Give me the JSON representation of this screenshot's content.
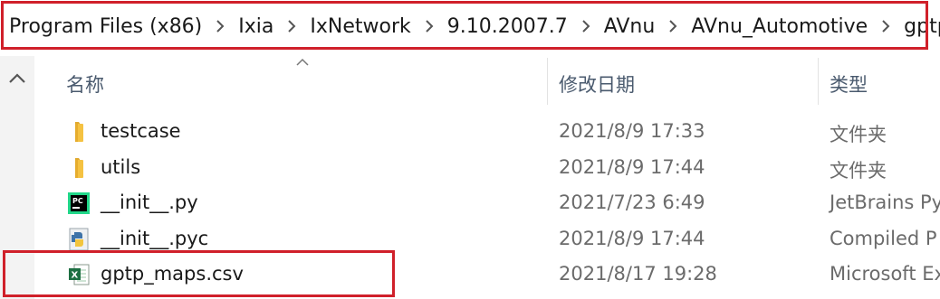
{
  "breadcrumb": {
    "segments": [
      "Program Files (x86)",
      "Ixia",
      "IxNetwork",
      "9.10.2007.7",
      "AVnu",
      "AVnu_Automotive",
      "gptp"
    ]
  },
  "columns": {
    "name": "名称",
    "date_modified": "修改日期",
    "type": "类型"
  },
  "files": [
    {
      "name": "testcase",
      "date": "2021/8/9 17:33",
      "type": "文件夹",
      "icon": "folder-icon"
    },
    {
      "name": "utils",
      "date": "2021/8/9 17:44",
      "type": "文件夹",
      "icon": "folder-icon"
    },
    {
      "name": "__init__.py",
      "date": "2021/7/23 6:49",
      "type": "JetBrains Py",
      "icon": "pycharm-file-icon"
    },
    {
      "name": "__init__.pyc",
      "date": "2021/8/9 17:44",
      "type": "Compiled P",
      "icon": "python-compiled-icon"
    },
    {
      "name": "gptp_maps.csv",
      "date": "2021/8/17 19:28",
      "type": "Microsoft Ex",
      "icon": "excel-csv-icon"
    }
  ],
  "colors": {
    "highlight": "#d0202a",
    "folder": "#f5c242",
    "pycharm_green": "#21d789",
    "excel_green": "#1d6f42"
  }
}
